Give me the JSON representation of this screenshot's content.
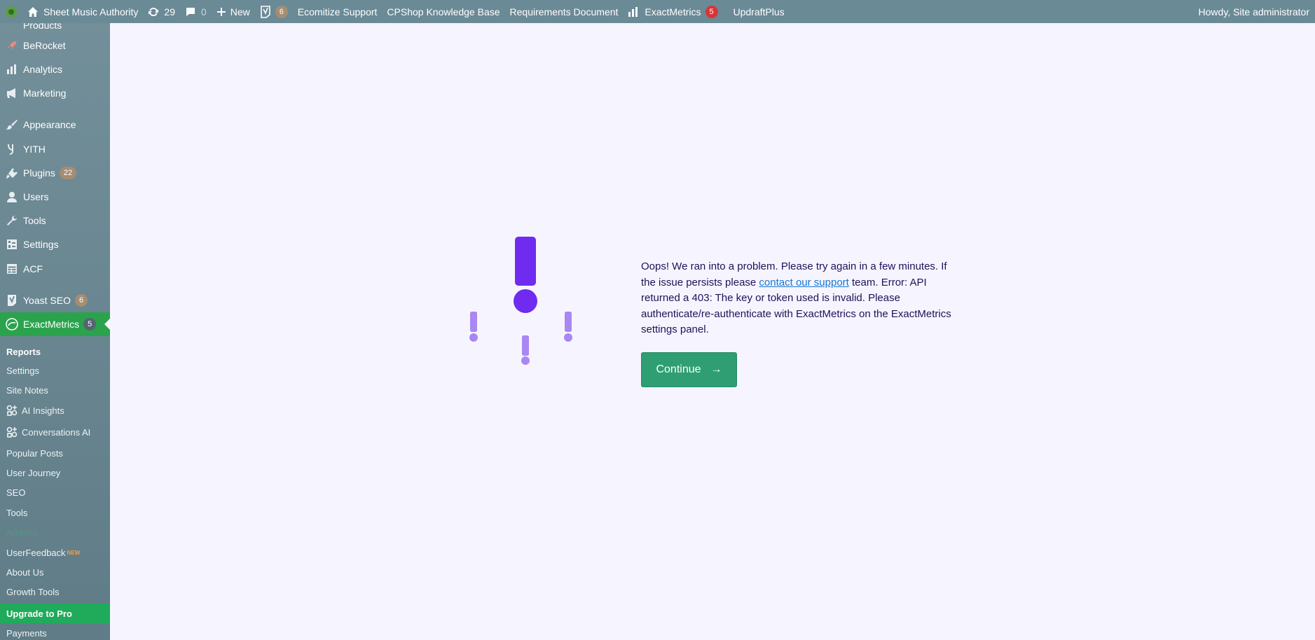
{
  "adminbar": {
    "logo_icon": "site-logo-icon",
    "site_name": "Sheet Music Authority",
    "updates_count": "29",
    "comments_count": "0",
    "new_label": "New",
    "yoast_count": "6",
    "links": [
      "Ecomitize Support",
      "CPShop Knowledge Base",
      "Requirements Document"
    ],
    "exactmetrics_label": "ExactMetrics",
    "exactmetrics_count": "5",
    "updraft_label": "UpdraftPlus",
    "howdy": "Howdy, Site administrator"
  },
  "sidebar": {
    "partial_top": "Products",
    "items": [
      {
        "label": "BeRocket",
        "icon": "rocket-icon"
      },
      {
        "label": "Analytics",
        "icon": "bar-chart-icon"
      },
      {
        "label": "Marketing",
        "icon": "megaphone-icon"
      },
      {
        "label": "Appearance",
        "icon": "paintbrush-icon"
      },
      {
        "label": "YITH",
        "icon": "yith-icon"
      },
      {
        "label": "Plugins",
        "icon": "plugin-icon",
        "badge": "22"
      },
      {
        "label": "Users",
        "icon": "users-icon"
      },
      {
        "label": "Tools",
        "icon": "wrench-icon"
      },
      {
        "label": "Settings",
        "icon": "settings-icon"
      },
      {
        "label": "ACF",
        "icon": "table-icon"
      },
      {
        "label": "Yoast SEO",
        "icon": "yoast-icon",
        "badge": "6"
      },
      {
        "label": "ExactMetrics",
        "icon": "exactmetrics-icon",
        "badge": "5"
      }
    ],
    "submenu": [
      "Reports",
      "Settings",
      "Site Notes",
      "AI Insights",
      "Conversations AI",
      "Popular Posts",
      "User Journey",
      "SEO",
      "Tools",
      "Addons",
      "UserFeedback",
      "About Us",
      "Growth Tools",
      "Upgrade to Pro",
      "Payments"
    ],
    "new_tag": "NEW"
  },
  "main": {
    "message_before": "Oops! We ran into a problem. Please try again in a few minutes. If the issue persists please ",
    "support_link": "contact our support",
    "message_after": " team. Error: API returned a 403: The key or token used is invalid. Please authenticate/re-authenticate with ExactMetrics on the ExactMetrics settings panel.",
    "continue_label": "Continue",
    "continue_arrow": "→",
    "colors": {
      "primary_exclaim": "#6f2bf0",
      "secondary_exclaim": "#a987f3",
      "button": "#2f9e72",
      "text": "#210f59"
    }
  }
}
